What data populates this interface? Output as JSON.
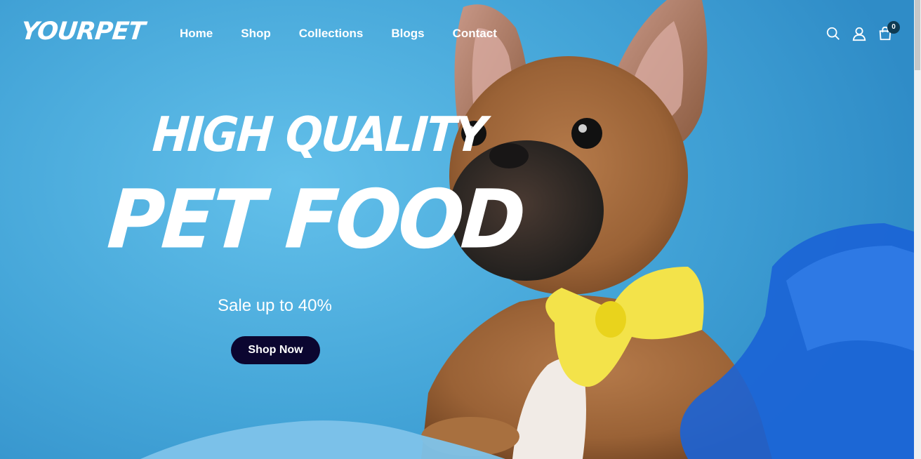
{
  "header": {
    "logo": "YOURPET",
    "nav": [
      {
        "label": "Home"
      },
      {
        "label": "Shop"
      },
      {
        "label": "Collections"
      },
      {
        "label": "Blogs"
      },
      {
        "label": "Contact"
      }
    ],
    "icons": [
      "search-icon",
      "user-icon",
      "cart-icon"
    ],
    "cart_count": "0"
  },
  "hero": {
    "title_line1": "HIGH QUALITY",
    "title_line2": "PET FOOD",
    "subtitle": "Sale up to 40%",
    "cta_label": "Shop Now",
    "image": "french-bulldog-puppy-with-yellow-bow-tie"
  },
  "colors": {
    "background": "#49a9d8",
    "cta_background": "#0b0630",
    "badge": "#0e3a52",
    "text": "#ffffff"
  }
}
